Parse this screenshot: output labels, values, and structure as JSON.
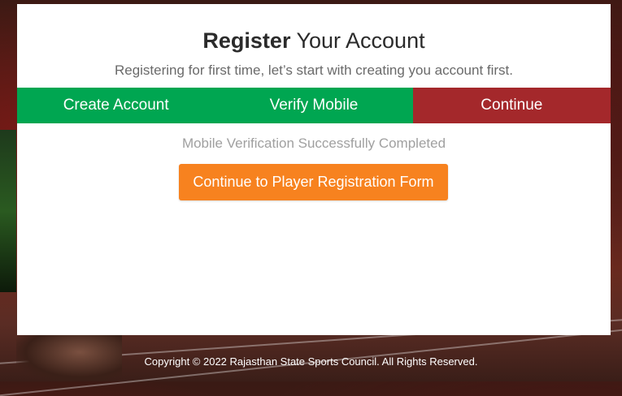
{
  "header": {
    "title_bold": "Register",
    "title_rest": " Your Account",
    "subtitle": "Registering for first time, let’s start with creating you account first."
  },
  "steps": [
    {
      "label": "Create Account",
      "state": "completed",
      "color": "#00a651"
    },
    {
      "label": "Verify Mobile",
      "state": "completed",
      "color": "#00a651"
    },
    {
      "label": "Continue",
      "state": "active",
      "color": "#a4282b"
    }
  ],
  "status_message": "Mobile Verification Successfully Completed",
  "cta": {
    "label": "Continue to Player Registration Form",
    "color": "#f7821f"
  },
  "footer": {
    "copyright": "Copyright © 2022 Rajasthan State Sports Council. All Rights Reserved."
  }
}
